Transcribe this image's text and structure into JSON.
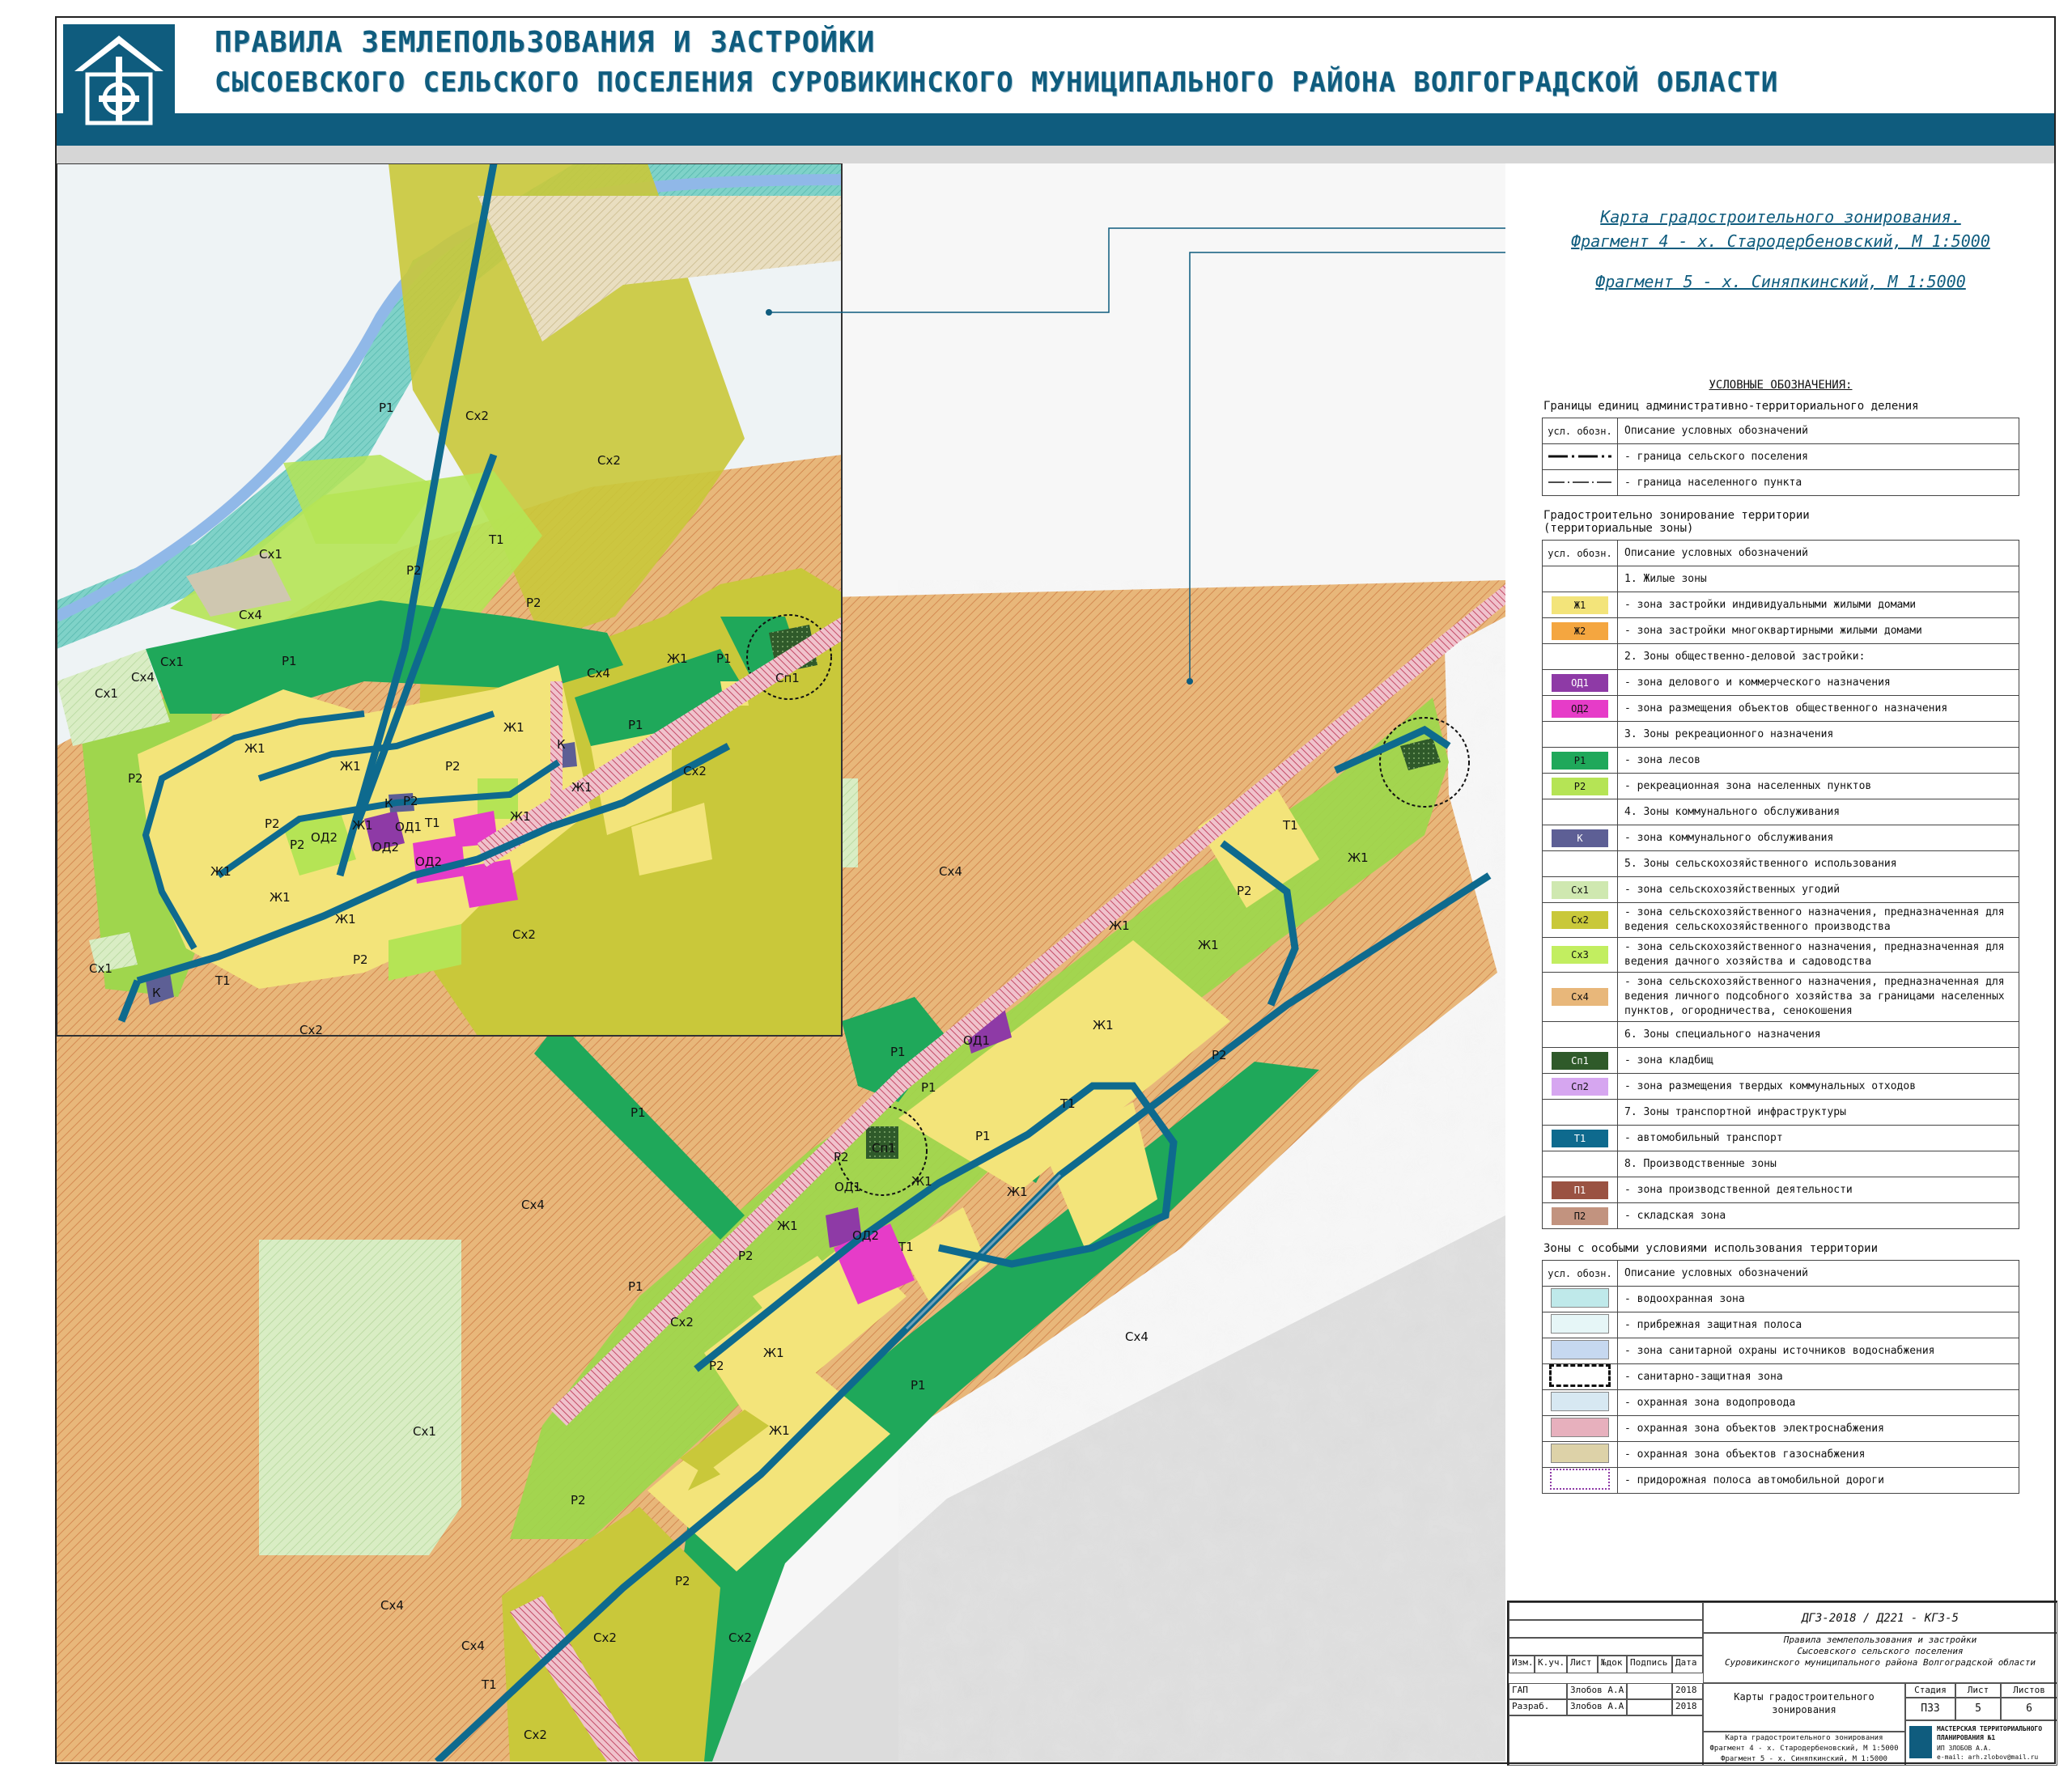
{
  "header": {
    "title_line1": "ПРАВИЛА ЗЕМЛЕПОЛЬЗОВАНИЯ И ЗАСТРОЙКИ",
    "title_line2": "СЫСОЕВСКОГО СЕЛЬСКОГО ПОСЕЛЕНИЯ СУРОВИКИНСКОГО МУНИЦИПАЛЬНОГО РАЙОНА ВОЛГОГРАДСКОЙ ОБЛАСТИ"
  },
  "fragments": {
    "map_title": "Карта градостроительного зонирования.",
    "fragment4": "Фрагмент 4 - х. Стародербеновский, М 1:5000",
    "fragment5": "Фрагмент 5 - х. Синяпкинский, М 1:5000"
  },
  "colors": {
    "brand": "#0f5c7e",
    "Zh1": "#f3e47a",
    "Zh2": "#f4a640",
    "OD1": "#8e3aa6",
    "OD2": "#e63cc8",
    "R1": "#1fa85a",
    "R2": "#b5e455",
    "K": "#5d5f95",
    "Sx1": "#cfe8b0",
    "Sx2": "#c9c83a",
    "Sx3": "#c2ee60",
    "Sx4": "#e8b77a",
    "Sp1": "#2f5a2a",
    "Sp2": "#d6a6f0",
    "T1": "#0e6a8e",
    "P1": "#9a5242",
    "P2": "#c2937f"
  },
  "map_labels": {
    "Zh1": "Ж1",
    "OD1": "ОД1",
    "OD2": "ОД2",
    "R1": "Р1",
    "R2": "Р2",
    "K": "К",
    "Sx1": "Сх1",
    "Sx2": "Сх2",
    "Sx4": "Сх4",
    "Sp1": "Сп1",
    "T1": "Т1"
  },
  "legend": {
    "title": "УСЛОВНЫЕ ОБОЗНАЧЕНИЯ:",
    "section1_title": "Границы единиц административно-территориального деления",
    "col_symbol": "усл. обозн.",
    "col_description": "Описание условных обозначений",
    "boundaries": [
      {
        "desc": "- граница сельского поселения"
      },
      {
        "desc": "- граница населенного пункта"
      }
    ],
    "section2_title_line1": "Градостроительно зонирование территории",
    "section2_title_line2": "(территориальные зоны)",
    "zones": [
      {
        "code": "",
        "color": "",
        "desc": "1. Жилые зоны"
      },
      {
        "code": "Ж1",
        "color": "#f3e47a",
        "desc": "- зона застройки индивидуальными жилыми домами"
      },
      {
        "code": "Ж2",
        "color": "#f4a640",
        "desc": "- зона застройки многоквартирными жилыми домами"
      },
      {
        "code": "",
        "color": "",
        "desc": "2. Зоны общественно-деловой застройки:"
      },
      {
        "code": "ОД1",
        "color": "#8e3aa6",
        "desc": "- зона делового и коммерческого назначения"
      },
      {
        "code": "ОД2",
        "color": "#e63cc8",
        "desc": "- зона размещения объектов общественного назначения"
      },
      {
        "code": "",
        "color": "",
        "desc": "3. Зоны рекреационного назначения"
      },
      {
        "code": "Р1",
        "color": "#1fa85a",
        "desc": "- зона лесов"
      },
      {
        "code": "Р2",
        "color": "#b5e455",
        "desc": "- рекреационная зона населенных пунктов"
      },
      {
        "code": "",
        "color": "",
        "desc": "4. Зоны коммунального обслуживания"
      },
      {
        "code": "К",
        "color": "#5d5f95",
        "desc": "- зона коммунального обслуживания"
      },
      {
        "code": "",
        "color": "",
        "desc": "5. Зоны сельскохозяйственного использования"
      },
      {
        "code": "Сх1",
        "color": "#cfe8b0",
        "desc": "- зона сельскохозяйственных угодий"
      },
      {
        "code": "Сх2",
        "color": "#c9c83a",
        "desc": "- зона сельскохозяйственного назначения, предназначенная для ведения сельскохозяйственного производства"
      },
      {
        "code": "Сх3",
        "color": "#c2ee60",
        "desc": "- зона сельскохозяйственного назначения, предназначенная для ведения дачного хозяйства и садоводства"
      },
      {
        "code": "Сх4",
        "color": "#e8b77a",
        "desc": "- зона сельскохозяйственного назначения, предназначенная для ведения личного подсобного хозяйства за границами населенных пунктов, огородничества, сенокошения"
      },
      {
        "code": "",
        "color": "",
        "desc": "6. Зоны специального назначения"
      },
      {
        "code": "Сп1",
        "color": "#2f5a2a",
        "desc": "- зона кладбищ"
      },
      {
        "code": "Сп2",
        "color": "#d6a6f0",
        "desc": "- зона размещения твердых коммунальных отходов"
      },
      {
        "code": "",
        "color": "",
        "desc": "7. Зоны транспортной инфраструктуры"
      },
      {
        "code": "Т1",
        "color": "#0e6a8e",
        "desc": "- автомобильный транспорт"
      },
      {
        "code": "",
        "color": "",
        "desc": "8. Производственные зоны"
      },
      {
        "code": "П1",
        "color": "#9a5242",
        "desc": "- зона производственной деятельности"
      },
      {
        "code": "П2",
        "color": "#c2937f",
        "desc": "- складская зона"
      }
    ],
    "section3_title": "Зоны с особыми условиями использования территории",
    "special": [
      {
        "color": "#bfe9ea",
        "desc": "- водоохранная зона"
      },
      {
        "color": "#e6f6f7",
        "desc": "- прибрежная защитная полоса"
      },
      {
        "color": "#c6d8f0",
        "desc": "- зона санитарной охраны источников водоснабжения"
      },
      {
        "color": "#ffffff",
        "desc": "- санитарно-защитная зона"
      },
      {
        "color": "#d7e8f2",
        "desc": "- охранная зона водопровода"
      },
      {
        "color": "#e7b0bd",
        "desc": "- охранная зона объектов электроснабжения"
      },
      {
        "color": "#ddd2a8",
        "desc": "- охранная зона объектов газоснабжения"
      },
      {
        "color": "#ffffff",
        "desc": "- придорожная полоса автомобильной дороги"
      }
    ]
  },
  "stamp": {
    "code": "ДГЗ-2018 / Д221 - КГЗ-5",
    "project_line1": "Правила землепользования и застройки",
    "project_line2": "Сысоевского сельского поселения",
    "project_line3": "Суровикинского муниципального района Волгоградской области",
    "headers": [
      "Изм.",
      "К.уч.",
      "Лист",
      "№док",
      "Подпись",
      "Дата"
    ],
    "gap_role": "ГАП",
    "gap_name": "Злобов А.А.",
    "gap_date": "2018",
    "dev_role": "Разраб.",
    "dev_name": "Злобов А.А.",
    "dev_date": "2018",
    "doc_title_line1": "Карты градостроительного",
    "doc_title_line2": "зонирования",
    "stage_label": "Стадия",
    "sheet_label": "Лист",
    "sheets_label": "Листов",
    "stage": "ПЗЗ",
    "sheet": "5",
    "sheets": "6",
    "sheet_desc_line1": "Карта градостроительного зонирования",
    "sheet_desc_line2": "Фрагмент 4 - х. Стародербеновский, М 1:5000",
    "sheet_desc_line3": "Фрагмент 5 - х. Синяпкинский, М 1:5000",
    "org_line1": "МАСТЕРСКАЯ ТЕРРИТОРИАЛЬНОГО",
    "org_line2": "ПЛАНИРОВАНИЯ №1",
    "org_person": "ИП ЗЛОБОВ А.А.",
    "org_email": "e-mail: arh.zlobov@mail.ru"
  }
}
